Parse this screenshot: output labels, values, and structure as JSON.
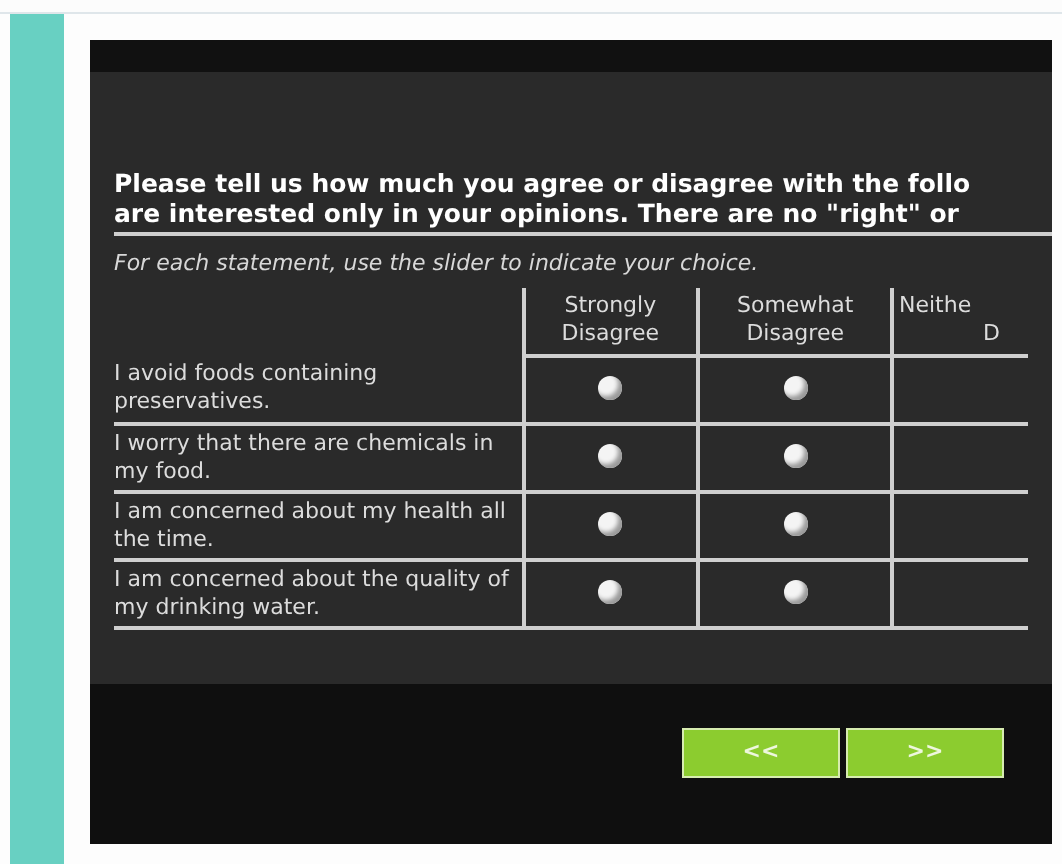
{
  "heading": [
    "Please tell us how much you agree or disagree with the follo",
    "are interested only in your opinions. There are no \"right\" or"
  ],
  "instruction": "For each statement, use the slider to indicate your choice.",
  "columns": [
    {
      "lines": [
        "Strongly",
        "Disagree"
      ]
    },
    {
      "lines": [
        "Somewhat",
        "Disagree"
      ]
    },
    {
      "lines": [
        "Neithe",
        "D"
      ]
    }
  ],
  "rows": [
    {
      "statement": "I avoid foods containing preservatives.",
      "choices": [
        {
          "selected": false
        },
        {
          "selected": false
        }
      ]
    },
    {
      "statement": "I worry that there are chemicals in my food.",
      "choices": [
        {
          "selected": false
        },
        {
          "selected": false
        }
      ]
    },
    {
      "statement": "I am concerned about my health all the time.",
      "choices": [
        {
          "selected": false
        },
        {
          "selected": false
        }
      ]
    },
    {
      "statement": "I am concerned about the quality of my drinking water.",
      "choices": [
        {
          "selected": false
        },
        {
          "selected": false
        }
      ]
    }
  ],
  "buttons": [
    "<<",
    ">>"
  ]
}
